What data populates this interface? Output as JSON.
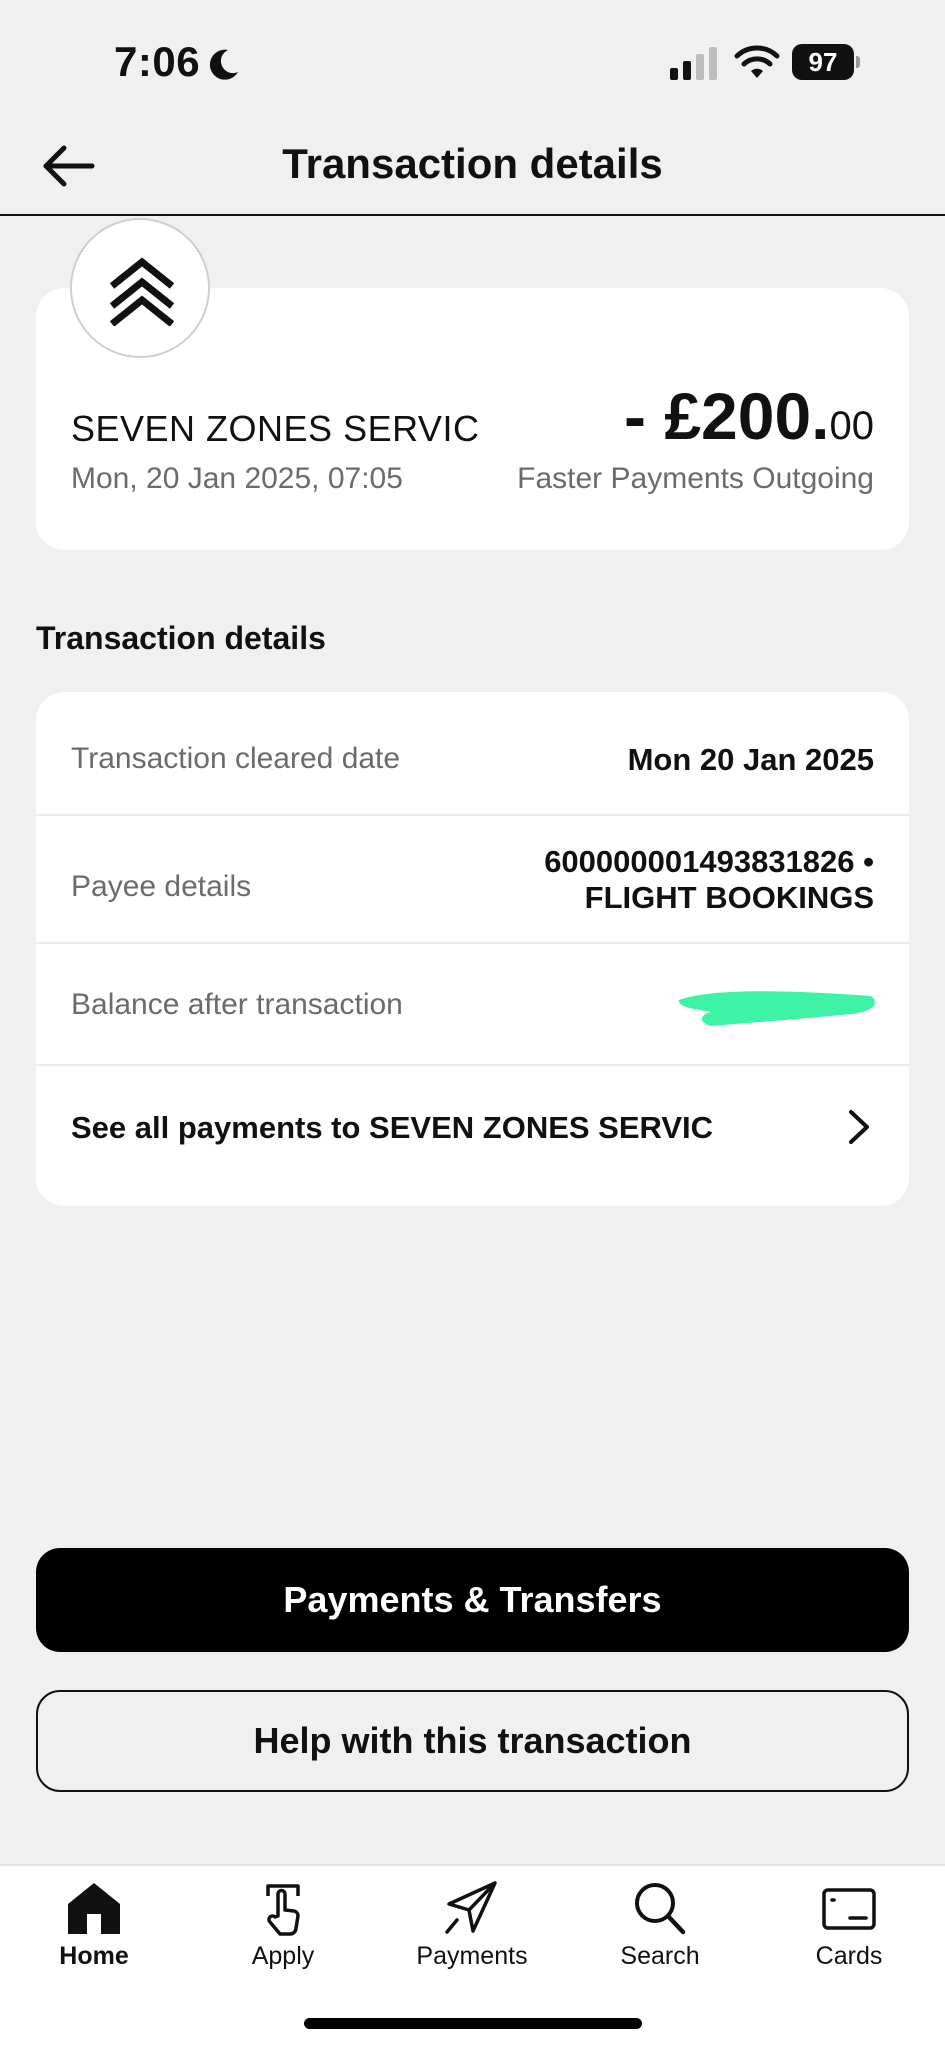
{
  "status_bar": {
    "time": "7:06",
    "battery": "97",
    "icons": [
      "moon-icon",
      "signal-icon",
      "wifi-icon",
      "battery-icon"
    ]
  },
  "header": {
    "title": "Transaction details",
    "back_icon": "arrow-left-icon"
  },
  "summary": {
    "merchant_name": "SEVEN ZONES SERVIC",
    "date_time": "Mon, 20 Jan 2025, 07:05",
    "amount_major": "- £200.",
    "amount_minor": "00",
    "payment_type": "Faster Payments Outgoing",
    "logo_icon": "chevron-up-double-icon"
  },
  "details": {
    "section_title": "Transaction details",
    "rows": [
      {
        "label": "Transaction cleared date",
        "value": "Mon 20 Jan 2025"
      },
      {
        "label": "Payee details",
        "value_line1": "60000000149383182​6 •",
        "value_line2": "FLIGHT BOOKINGS"
      },
      {
        "label": "Balance after transaction",
        "value": ""
      }
    ],
    "see_all_label": "See all payments to SEVEN ZONES SERVIC"
  },
  "actions": {
    "primary": "Payments & Transfers",
    "secondary": "Help with this transaction"
  },
  "tabs": [
    {
      "label": "Home",
      "icon": "home-icon",
      "active": true
    },
    {
      "label": "Apply",
      "icon": "tap-hand-icon",
      "active": false
    },
    {
      "label": "Payments",
      "icon": "payments-icon",
      "active": false
    },
    {
      "label": "Search",
      "icon": "search-icon",
      "active": false
    },
    {
      "label": "Cards",
      "icon": "card-icon",
      "active": false
    }
  ],
  "colors": {
    "background": "#f0f0f0",
    "card": "#ffffff",
    "primary_button": "#000000",
    "muted_text": "#6b6b6b",
    "redaction": "#3ef2a6"
  }
}
